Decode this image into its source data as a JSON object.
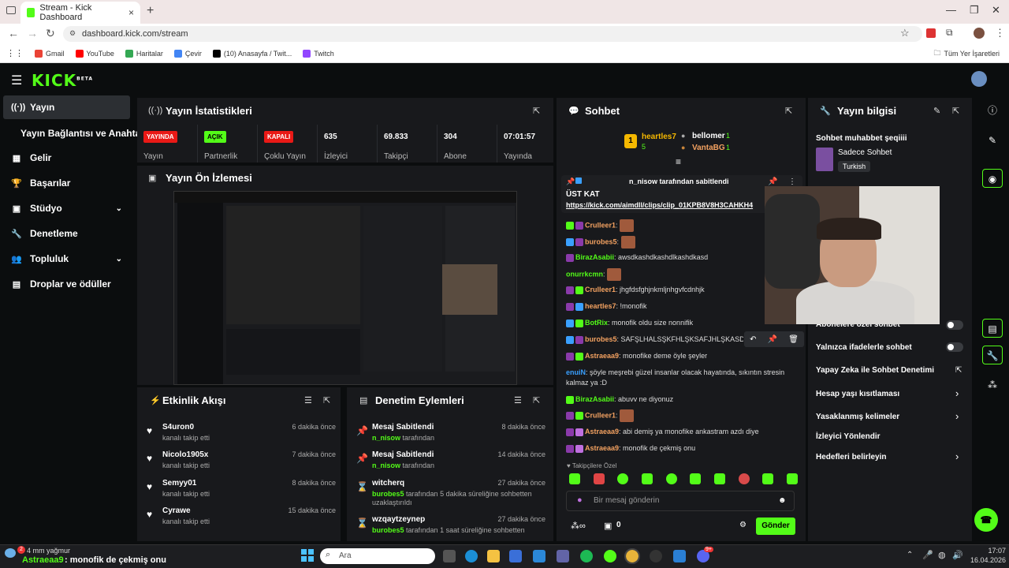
{
  "browser": {
    "tab_title": "Stream - Kick Dashboard",
    "url": "dashboard.kick.com/stream",
    "bookmarks": [
      "Gmail",
      "YouTube",
      "Haritalar",
      "Çevir",
      "(10) Anasayfa / Twit...",
      "Twitch"
    ],
    "bookmark_colors": [
      "#ea4335",
      "#ff0000",
      "#34a853",
      "#4285f4",
      "#000000",
      "#9146ff"
    ],
    "bookmarks_right": "Tüm Yer İşaretleri"
  },
  "app": {
    "logo": "KICK",
    "logo_sup": "BETA",
    "accent": "#53fc18"
  },
  "sidebar": {
    "items": [
      {
        "label": "Yayın",
        "icon": "broadcast-icon",
        "glyph": "((·))"
      },
      {
        "label": "Yayın Bağlantısı ve Anahtarı",
        "icon": "",
        "glyph": ""
      },
      {
        "label": "Gelir",
        "icon": "chart-icon",
        "glyph": "▦"
      },
      {
        "label": "Başarılar",
        "icon": "trophy-icon",
        "glyph": "🏆"
      },
      {
        "label": "Stüdyo",
        "icon": "studio-icon",
        "glyph": "▣",
        "chev": "⌄"
      },
      {
        "label": "Denetleme",
        "icon": "wrench-icon",
        "glyph": "🔧"
      },
      {
        "label": "Topluluk",
        "icon": "community-icon",
        "glyph": "👥",
        "chev": "⌄"
      },
      {
        "label": "Droplar ve ödüller",
        "icon": "drops-icon",
        "glyph": "▤"
      }
    ]
  },
  "stats": {
    "title": "Yayın İstatistikleri",
    "items": [
      {
        "top": "YAYINDA",
        "label": "Yayın",
        "badge": true,
        "color": "#e91916"
      },
      {
        "top": "AÇIK",
        "label": "Partnerlik",
        "badge": true,
        "color": "#53fc18"
      },
      {
        "top": "KAPALI",
        "label": "Çoklu Yayın",
        "badge": true,
        "color": "#e91916"
      },
      {
        "top": "635",
        "label": "İzleyici"
      },
      {
        "top": "69.833",
        "label": "Takipçi"
      },
      {
        "top": "304",
        "label": "Abone"
      },
      {
        "top": "07:01:57",
        "label": "Yayında"
      }
    ]
  },
  "preview": {
    "title": "Yayın Ön İzlemesi"
  },
  "events": {
    "title": "Etkinlik Akışı",
    "items": [
      {
        "name": "S4uron0",
        "sub": "kanalı takip etti",
        "time": "6 dakika önce"
      },
      {
        "name": "Nicolo1905x",
        "sub": "kanalı takip etti",
        "time": "7 dakika önce"
      },
      {
        "name": "Semyy01",
        "sub": "kanalı takip etti",
        "time": "8 dakika önce"
      },
      {
        "name": "Cyrawe",
        "sub": "kanalı takip etti",
        "time": "15 dakika önce"
      }
    ]
  },
  "moderation": {
    "title": "Denetim Eylemleri",
    "items": [
      {
        "name": "Mesaj Sabitlendi",
        "actor": "n_nisow",
        "sub": "tarafından",
        "time": "8 dakika önce",
        "icon": "pin-icon",
        "glyph": "📌"
      },
      {
        "name": "Mesaj Sabitlendi",
        "actor": "n_nisow",
        "sub": "tarafından",
        "time": "14 dakika önce",
        "icon": "pin-icon",
        "glyph": "📌"
      },
      {
        "name": "witcherq",
        "actor": "burobes5",
        "sub": "tarafından 5 dakika süreliğine sohbetten uzaklaştırıldı",
        "time": "27 dakika önce",
        "icon": "hourglass-icon",
        "glyph": "⌛"
      },
      {
        "name": "wzqaytzeynep",
        "actor": "burobes5",
        "sub": "tarafından 1 saat süreliğine sohbetten",
        "time": "27 dakika önce",
        "icon": "hourglass-icon",
        "glyph": "⌛"
      }
    ]
  },
  "chat": {
    "title": "Sohbet",
    "leaders": {
      "first": "heartles7",
      "first_count": "5",
      "second": "bellomer",
      "second_count": "1",
      "third": "VantaBG",
      "third_count": "1",
      "rank": "1"
    },
    "pinned": {
      "header": "n_nisow tarafından sabitlendi",
      "text": "ÜST KAT",
      "link": "https://kick.com/aimdll/clips/clip_01KPB8V8H3CAHKH4"
    },
    "messages": [
      {
        "user": "Crulleer1",
        "color": "#f4a261",
        "text": "",
        "emote": true
      },
      {
        "user": "burobes5",
        "color": "#f4a261",
        "text": "",
        "emote": true
      },
      {
        "user": "BirazAsabii",
        "color": "#53fc18",
        "text": "awsdkashdkashdlkashdkasd"
      },
      {
        "user": "onurrkcmn",
        "color": "#53fc18",
        "text": "",
        "emote": true
      },
      {
        "user": "Crulleer1",
        "color": "#f4a261",
        "text": "jhgfdsfghjnkmljnhgvfcdnhjk"
      },
      {
        "user": "heartles7",
        "color": "#f4a261",
        "text": "!monofik"
      },
      {
        "user": "BotRix",
        "color": "#53fc18",
        "text": "monofik oldu size nonnifik"
      },
      {
        "user": "burobes5",
        "color": "#f4a261",
        "text": "SAFŞLHALSŞKFHLŞKSAFJHLŞKASDL"
      },
      {
        "user": "Astraeaa9",
        "color": "#f4a261",
        "text": "monofike deme öyle şeyler"
      },
      {
        "user": "enuiN",
        "color": "#3aa0ff",
        "text": "şöyle meşrebi güzel insanlar olacak hayatında, sıkıntın stresin kalmaz ya :D"
      },
      {
        "user": "BirazAsabii",
        "color": "#53fc18",
        "text": "abuvv ne diyonuz"
      },
      {
        "user": "Crulleer1",
        "color": "#f4a261",
        "text": "",
        "emote": true
      },
      {
        "user": "Astraeaa9",
        "color": "#f4a261",
        "text": "abi demiş ya monofike ankastram azdı diye"
      },
      {
        "user": "Astraeaa9",
        "color": "#f4a261",
        "text": "monofik de çekmiş onu"
      }
    ],
    "followers_only": "Takipçilere Özel",
    "input_placeholder": "Bir mesaj gönderin",
    "points": "0",
    "send": "Gönder"
  },
  "info": {
    "title": "Yayın bilgisi",
    "stream_title": "Sohbet muhabbet şeqiiii",
    "category": "Sadece Sohbet",
    "tag": "Turkish",
    "items": [
      {
        "label": "Abonelere özel sohbet",
        "kind": "toggle"
      },
      {
        "label": "Yalnızca ifadelerle sohbet",
        "kind": "toggle"
      },
      {
        "label": "Yapay Zeka ile Sohbet Denetimi",
        "kind": "ext"
      },
      {
        "label": "Hesap yaşı kısıtlaması",
        "kind": "chev"
      },
      {
        "label": "Yasaklanmış kelimeler",
        "kind": "chev"
      },
      {
        "label": "İzleyici Yönlendir",
        "kind": "none"
      },
      {
        "label": "Hedefleri belirleyin",
        "kind": "chev"
      }
    ]
  },
  "taskbar": {
    "weather": "4 mm yağmur",
    "notif_count": "2",
    "ticker_user": "Astraeaa9",
    "ticker_text": ": monofik de çekmiş onu",
    "search": "Ara",
    "time": "17:07",
    "date": "16.04.2026",
    "discord_badge": "9+"
  }
}
